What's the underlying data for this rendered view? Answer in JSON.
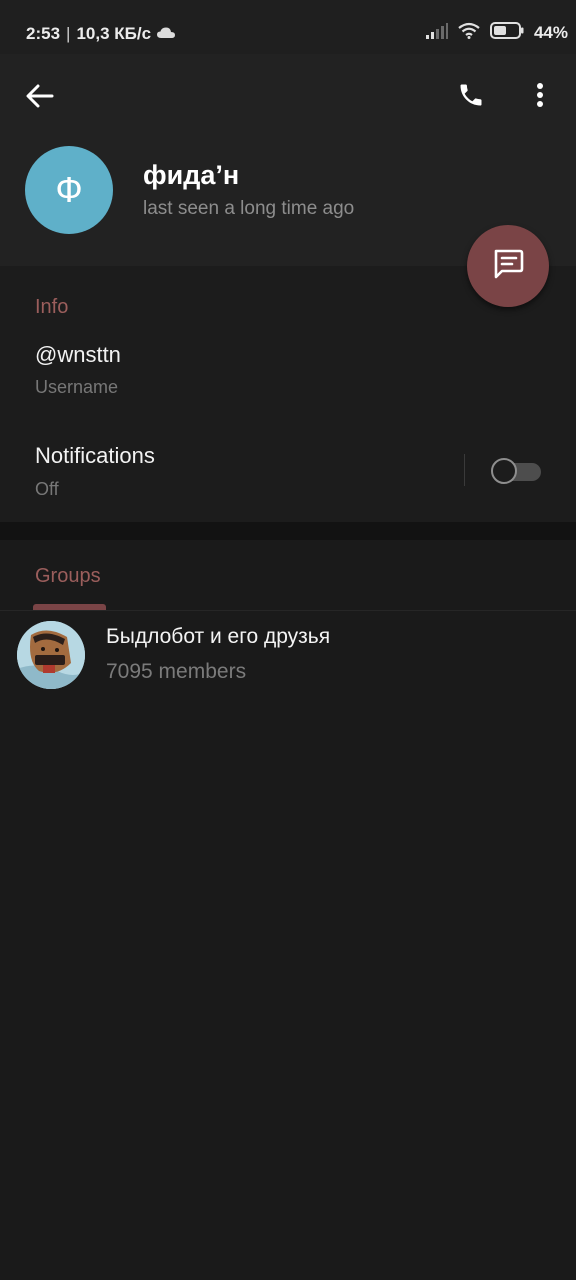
{
  "status_bar": {
    "time": "2:53",
    "net_speed": "10,3 КБ/с",
    "battery_percent": "44%",
    "icons": [
      "cloud-icon",
      "signal-icon",
      "wifi-icon",
      "battery-icon"
    ]
  },
  "header": {
    "back_icon": "arrow-left-icon",
    "call_icon": "phone-icon",
    "menu_icon": "more-vertical-icon",
    "avatar_letter": "Ф",
    "avatar_color": "#5fb0c9",
    "name": "фида’н",
    "status": "last seen a long time ago"
  },
  "fab": {
    "icon": "message-icon",
    "color": "#7a4446"
  },
  "info": {
    "title": "Info",
    "username_value": "@wnsttn",
    "username_label": "Username",
    "notifications_label": "Notifications",
    "notifications_value": "Off",
    "notifications_enabled": false
  },
  "groups": {
    "title": "Groups",
    "items": [
      {
        "name": "Быдлобот и его друзья",
        "members": "7095 members"
      }
    ]
  },
  "colors": {
    "accent": "#9b5e5c",
    "background": "#181818",
    "header_background": "#222222"
  }
}
